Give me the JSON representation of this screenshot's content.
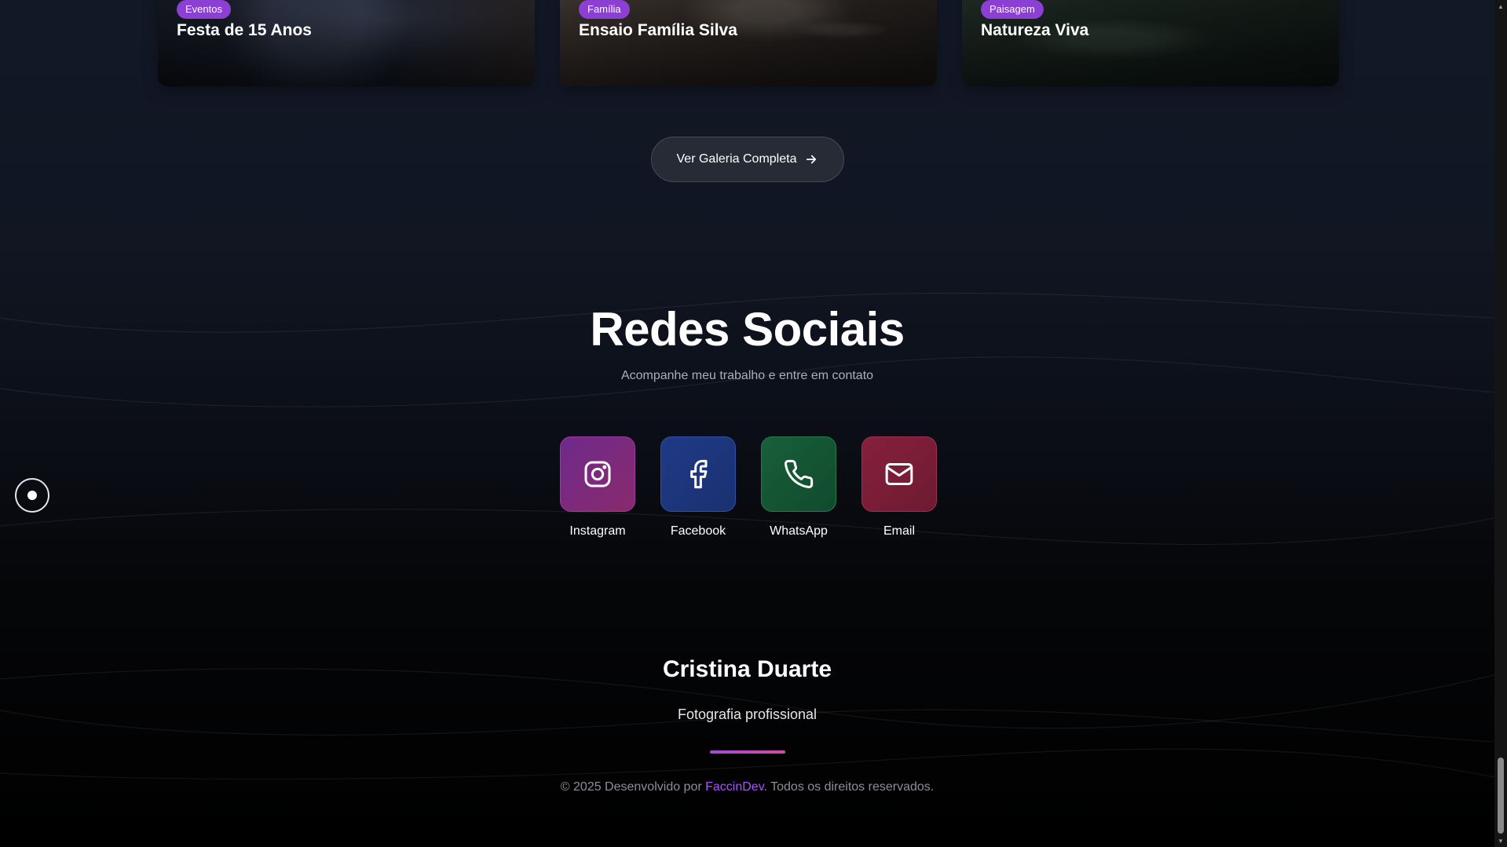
{
  "gallery": {
    "cards": [
      {
        "tag": "Eventos",
        "title": "Festa de 15 Anos"
      },
      {
        "tag": "Família",
        "title": "Ensaio Família Silva"
      },
      {
        "tag": "Paisagem",
        "title": "Natureza Viva"
      }
    ],
    "button_label": "Ver Galeria Completa",
    "button_icon": "arrow-right-icon"
  },
  "social": {
    "title": "Redes Sociais",
    "subtitle": "Acompanhe meu trabalho e entre em contato",
    "items": [
      {
        "label": "Instagram",
        "icon": "instagram-icon",
        "color": "#7a2a80"
      },
      {
        "label": "Facebook",
        "icon": "facebook-icon",
        "color": "#1f3a86"
      },
      {
        "label": "WhatsApp",
        "icon": "phone-icon",
        "color": "#17603a"
      },
      {
        "label": "Email",
        "icon": "mail-icon",
        "color": "#86203d"
      }
    ]
  },
  "footer": {
    "name": "Cristina Duarte",
    "tagline": "Fotografia profissional",
    "copyright_prefix": "© 2025 Desenvolvido por ",
    "developer": "FaccinDev",
    "copyright_suffix": ". Todos os direitos reservados.",
    "accent_color": "#a855f7"
  }
}
